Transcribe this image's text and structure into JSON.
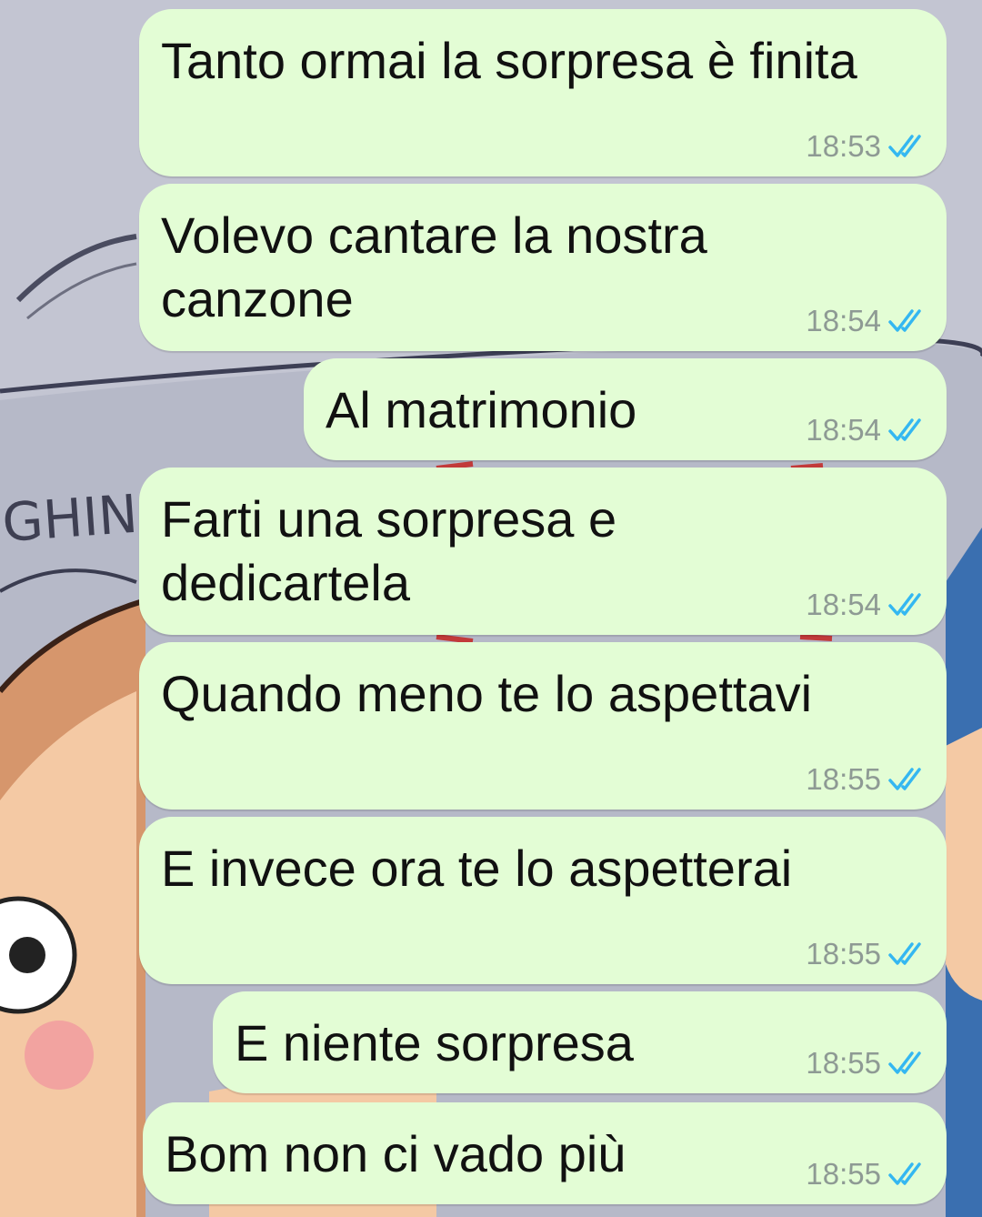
{
  "chat": {
    "messages": [
      {
        "text": "Tanto ormai la sorpresa è finita",
        "time": "18:53",
        "status": "read"
      },
      {
        "text": "Volevo cantare la nostra\ncanzone",
        "time": "18:54",
        "status": "read"
      },
      {
        "text": "Al matrimonio",
        "time": "18:54",
        "status": "read"
      },
      {
        "text": "Farti una sorpresa e\ndedicartela",
        "time": "18:54",
        "status": "read"
      },
      {
        "text": "Quando meno te lo aspettavi",
        "time": "18:55",
        "status": "read"
      },
      {
        "text": "E invece ora te lo aspetterai",
        "time": "18:55",
        "status": "read"
      },
      {
        "text": "E niente sorpresa",
        "time": "18:55",
        "status": "read"
      },
      {
        "text": "Bom non ci vado più",
        "time": "18:55",
        "status": "read"
      }
    ]
  },
  "wallpaper": {
    "fragment_text": "GHIN"
  },
  "colors": {
    "bubble": "#e3fdd5",
    "read_ticks": "#34b7f1",
    "time": "#8e9a94"
  }
}
